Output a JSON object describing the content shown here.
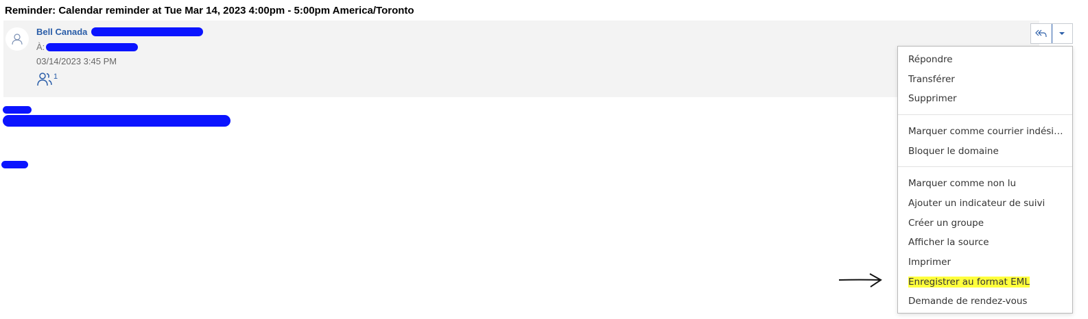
{
  "message": {
    "subject": "Reminder: Calendar reminder at Tue Mar 14, 2023 4:00pm - 5:00pm America/Toronto",
    "sender_name": "Bell Canada",
    "to_label": "À:",
    "date": "03/14/2023 3:45 PM",
    "participants_count": "1"
  },
  "toolbar": {
    "reply_all_icon": "reply-all-icon",
    "more_icon": "caret-down-icon"
  },
  "menu": {
    "items": [
      "Répondre",
      "Transférer",
      "Supprimer",
      "Marquer comme courrier indésirable",
      "Bloquer le domaine",
      "Marquer comme non lu",
      "Ajouter un indicateur de suivi",
      "Créer un groupe",
      "Afficher la source",
      "Imprimer",
      "Enregistrer au format EML",
      "Demande de rendez-vous"
    ],
    "highlight_color": "#ffff3c"
  },
  "colors": {
    "accent": "#2a5da8",
    "redaction": "#0b14ff",
    "header_background": "#f3f3f3"
  }
}
